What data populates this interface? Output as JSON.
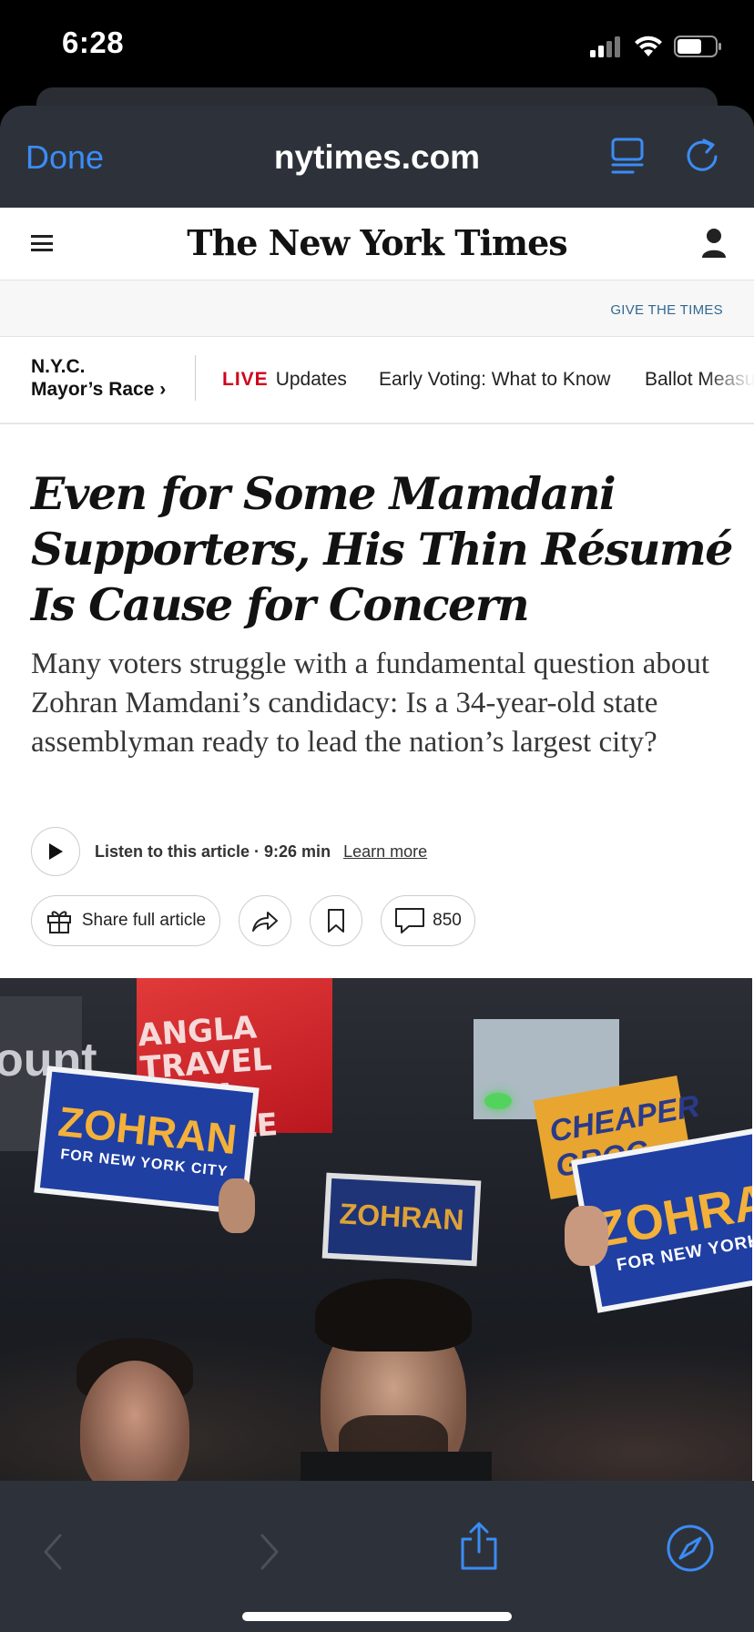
{
  "status_bar": {
    "time": "6:28"
  },
  "browser": {
    "done_label": "Done",
    "url": "nytimes.com",
    "accent_color": "#3b8cf6",
    "icons": [
      "reader-icon",
      "reload-icon"
    ]
  },
  "nyt": {
    "logo": "The New York Times",
    "give_link": "GIVE THE TIMES",
    "section_nav": {
      "title_line1": "N.Y.C.",
      "title_line2": "Mayor’s Race ›",
      "live_tag": "LIVE",
      "items": [
        "Updates",
        "Early Voting: What to Know",
        "Ballot Measu"
      ]
    }
  },
  "article": {
    "headline": "Even for Some Mamdani Supporters, His Thin Résumé Is Cause for Concern",
    "summary": "Many voters struggle with a fundamental question about Zohran Mamdani’s candidacy: Is a 34-year-old state assemblyman ready to lead the nation’s largest city?",
    "listen_text": "Listen to this article · 9:26 min",
    "learn_more": "Learn more",
    "share_full_label": "Share full article",
    "comment_count": "850"
  },
  "photo": {
    "sign_text": "ANGLA TRAVEL\nNGLA MOBILE",
    "left_sign_text": "ount",
    "placard_main": "ZOHRAN",
    "placard_sub": "FOR NEW YORK CITY",
    "placard_right": "ZOHRA",
    "placard_right_sub": "FOR NEW YORK",
    "orange_sign": "CHEAPER GROC"
  },
  "toolbar": {
    "icons": [
      "back-icon",
      "forward-icon",
      "share-icon",
      "compass-icon"
    ]
  }
}
